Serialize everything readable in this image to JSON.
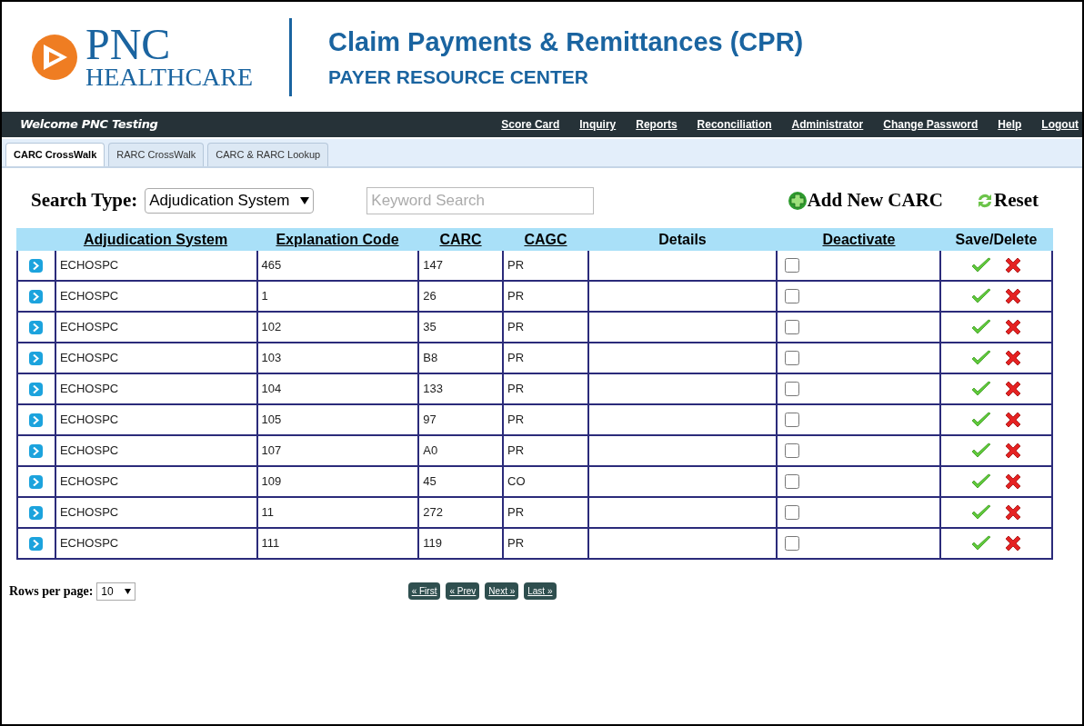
{
  "header": {
    "brand": "PNC",
    "brand_sub": "HEALTHCARE",
    "title": "Claim Payments & Remittances (CPR)",
    "subtitle": "PAYER RESOURCE CENTER"
  },
  "nav": {
    "welcome": "Welcome PNC Testing",
    "links": [
      "Score Card",
      "Inquiry",
      "Reports",
      "Reconciliation",
      "Administrator",
      "Change Password",
      "Help",
      "Logout"
    ]
  },
  "tabs": [
    {
      "label": "CARC CrossWalk",
      "selected": true
    },
    {
      "label": "RARC CrossWalk",
      "selected": false
    },
    {
      "label": "CARC & RARC Lookup",
      "selected": false
    }
  ],
  "search": {
    "label": "Search Type:",
    "type_value": "Adjudication System",
    "keyword_placeholder": "Keyword Search",
    "add_button": "Add New CARC",
    "reset_button": "Reset"
  },
  "table": {
    "columns": [
      {
        "label": "Adjudication System",
        "sortable": true
      },
      {
        "label": "Explanation Code",
        "sortable": true
      },
      {
        "label": "CARC",
        "sortable": true
      },
      {
        "label": "CAGC",
        "sortable": true
      },
      {
        "label": "Details",
        "sortable": false
      },
      {
        "label": "Deactivate",
        "sortable": true
      },
      {
        "label": "Save/Delete",
        "sortable": false
      }
    ],
    "rows": [
      {
        "system": "ECHOSPC",
        "code": "465",
        "carc": "147",
        "cagc": "PR",
        "deactivated": false
      },
      {
        "system": "ECHOSPC",
        "code": "1",
        "carc": "26",
        "cagc": "PR",
        "deactivated": false
      },
      {
        "system": "ECHOSPC",
        "code": "102",
        "carc": "35",
        "cagc": "PR",
        "deactivated": false
      },
      {
        "system": "ECHOSPC",
        "code": "103",
        "carc": "B8",
        "cagc": "PR",
        "deactivated": false
      },
      {
        "system": "ECHOSPC",
        "code": "104",
        "carc": "133",
        "cagc": "PR",
        "deactivated": false
      },
      {
        "system": "ECHOSPC",
        "code": "105",
        "carc": "97",
        "cagc": "PR",
        "deactivated": false
      },
      {
        "system": "ECHOSPC",
        "code": "107",
        "carc": "A0",
        "cagc": "PR",
        "deactivated": false
      },
      {
        "system": "ECHOSPC",
        "code": "109",
        "carc": "45",
        "cagc": "CO",
        "deactivated": false
      },
      {
        "system": "ECHOSPC",
        "code": "11",
        "carc": "272",
        "cagc": "PR",
        "deactivated": false
      },
      {
        "system": "ECHOSPC",
        "code": "111",
        "carc": "119",
        "cagc": "PR",
        "deactivated": false
      }
    ]
  },
  "pager": {
    "rows_label": "Rows per page:",
    "rows_value": "10",
    "buttons": [
      "« First",
      "« Prev",
      "Next »",
      "Last »"
    ]
  }
}
